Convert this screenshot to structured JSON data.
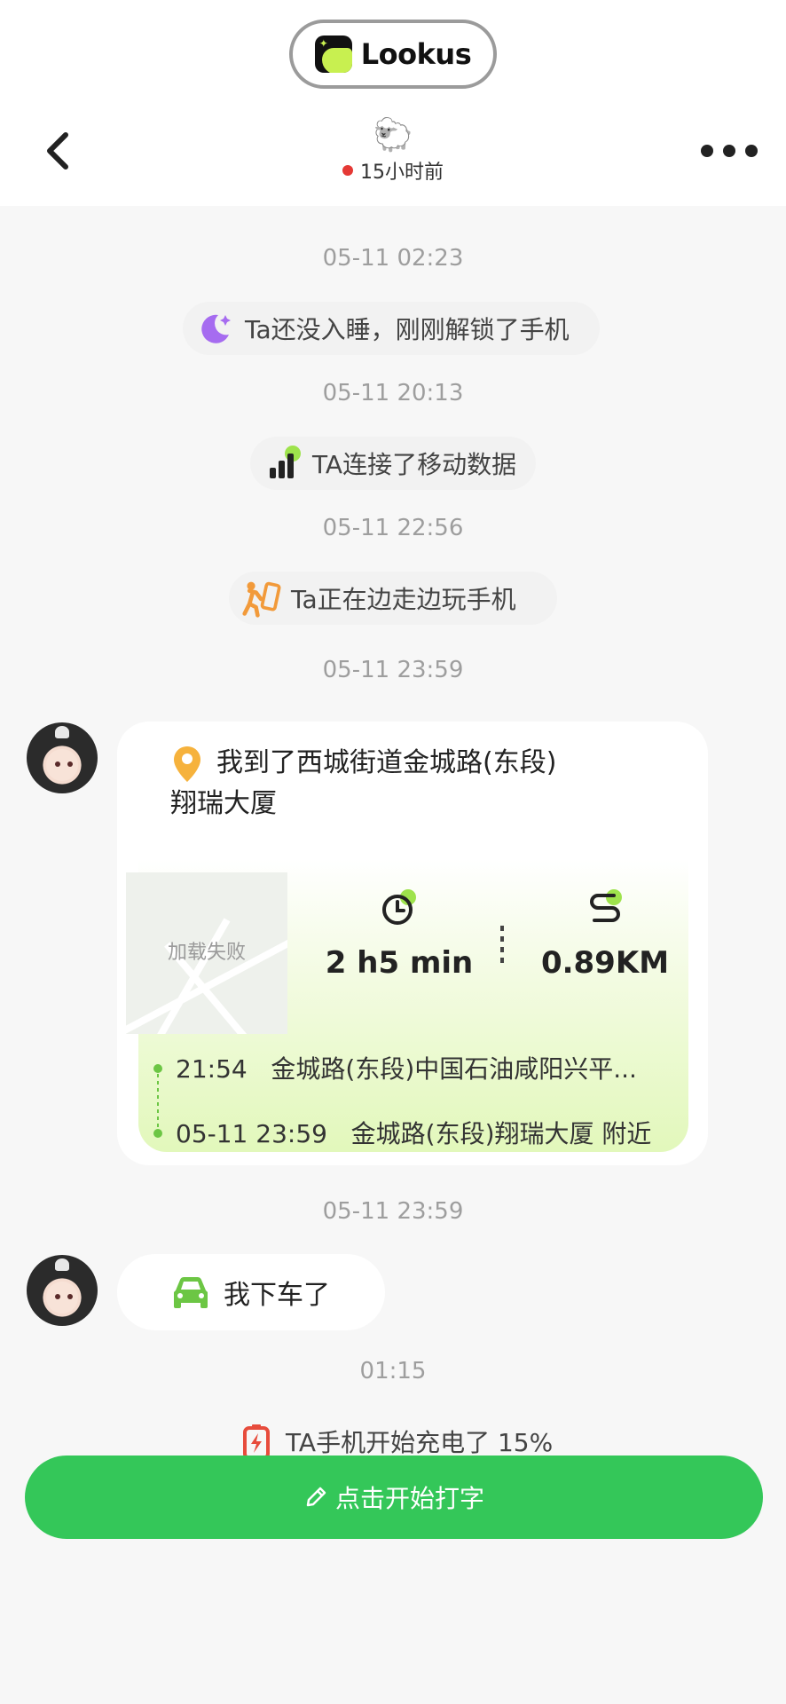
{
  "header": {
    "app_name": "Lookus",
    "contact_emoji": "🐑",
    "last_seen": "15小时前",
    "status_color": "#e53935"
  },
  "feed": [
    {
      "type": "time",
      "text": "05-11 02:23"
    },
    {
      "type": "event",
      "icon": "moon-icon",
      "text": "Ta还没入睡，刚刚解锁了手机"
    },
    {
      "type": "time",
      "text": "05-11 20:13"
    },
    {
      "type": "event",
      "icon": "signal-bars-icon",
      "text": "TA连接了移动数据"
    },
    {
      "type": "time",
      "text": "05-11 22:56"
    },
    {
      "type": "event",
      "icon": "walking-phone-icon",
      "text": "Ta正在边走边玩手机"
    },
    {
      "type": "time",
      "text": "05-11 23:59"
    },
    {
      "type": "time",
      "text": "05-11 23:59"
    },
    {
      "type": "time",
      "text": "01:15"
    },
    {
      "type": "event",
      "icon": "battery-charging-icon",
      "text": "TA手机开始充电了 15%"
    }
  ],
  "location_card": {
    "title": "我到了西城街道金城路(东段)翔瑞大厦",
    "map_placeholder": "加载失败",
    "duration": "2 h5 min",
    "distance": "0.89KM",
    "route": [
      {
        "time": "21:54",
        "place": "金城路(东段)中国石油咸阳兴平..."
      },
      {
        "time": "05-11 23:59",
        "place": "金城路(东段)翔瑞大厦 附近"
      }
    ]
  },
  "car_message": {
    "text": "我下车了",
    "icon": "car-icon"
  },
  "input_bar": {
    "label": "点击开始打字",
    "color": "#34c759"
  },
  "colors": {
    "accent_green": "#6cc644",
    "lime": "#c8f050",
    "orange": "#f29a3a",
    "purple": "#a66cf0"
  }
}
